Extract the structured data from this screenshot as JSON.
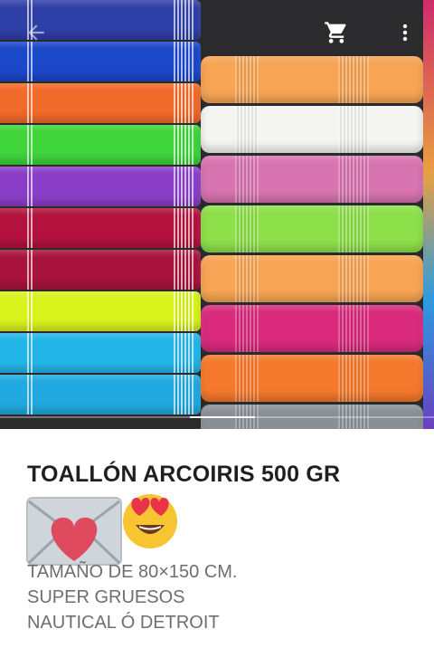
{
  "product": {
    "title": "TOALLÓN ARCOIRIS 500 GR",
    "description_lines": [
      "TAMAÑO DE 80×150 CM.",
      "SUPER GRUESOS",
      "NAUTICAL Ó DETROIT"
    ],
    "emojis": [
      "love-letter-emoji",
      "heart-eyes-emoji"
    ]
  },
  "app_bar": {
    "icons": [
      "back-arrow-icon",
      "shopping-cart-icon",
      "more-vert-icon"
    ]
  },
  "gallery": {
    "image": "photo of stacked rainbow towels",
    "left_stack_colors": [
      "#2f3fa8",
      "#1b47c9",
      "#f06a2a",
      "#3ed43a",
      "#8a3ec8",
      "#b3123e",
      "#a8133d",
      "#d8f21c",
      "#22b6e8",
      "#20a9e0"
    ],
    "right_stack_colors": [
      "#f7a454",
      "#f4f4f2",
      "#d874b0",
      "#8ee04a",
      "#f7a454",
      "#d92a7c",
      "#f4792c",
      "#8a8f96"
    ]
  },
  "colors": {
    "title_text": "#1f1f1f",
    "body_text": "#6e6e6e",
    "background": "#ffffff"
  }
}
